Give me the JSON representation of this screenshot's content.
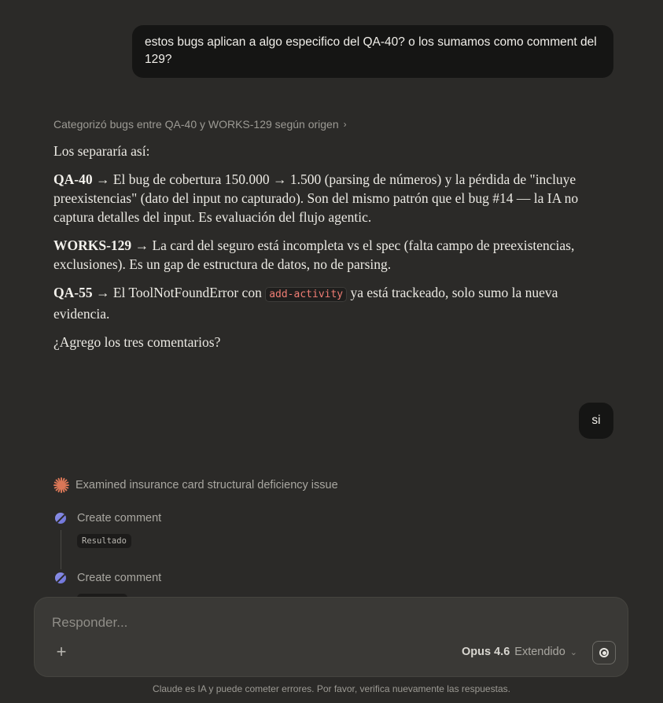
{
  "messages": {
    "user_1": "estos bugs aplican a algo especifico del QA-40? o los sumamos como comment del 129?",
    "user_2": "si"
  },
  "assistant": {
    "thinking_summary": "Categorizó bugs entre QA-40 y WORKS-129 según origen",
    "intro": "Los separaría así:",
    "items": [
      {
        "key": "QA-40",
        "arrow": "→",
        "text": "El bug de cobertura 150.000 → 1.500 (parsing de números) y la pérdida de \"incluye preexistencias\" (dato del input no capturado). Son del mismo patrón que el bug #14 — la IA no captura detalles del input. Es evaluación del flujo agentic."
      },
      {
        "key": "WORKS-129",
        "arrow": "→",
        "text": "La card del seguro está incompleta vs el spec (falta campo de preexistencias, exclusiones). Es un gap de estructura de datos, no de parsing."
      },
      {
        "key": "QA-55",
        "arrow": "→",
        "text_before": "El ToolNotFoundError con",
        "code": "add-activity",
        "text_after": "ya está trackeado, solo sumo la nueva evidencia."
      }
    ],
    "question": "¿Agrego los tres comentarios?"
  },
  "activity": {
    "header": "Examined insurance card structural deficiency issue",
    "header_icon": "sparkle-icon",
    "tools": [
      {
        "label": "Create comment",
        "result": "Resultado",
        "icon": "tool-dot-icon"
      },
      {
        "label": "Create comment",
        "icon": "tool-dot-icon"
      }
    ]
  },
  "composer": {
    "placeholder": "Responder...",
    "model_name": "Opus 4.6",
    "model_mode": "Extendido",
    "plus_icon": "plus-icon",
    "voice_icon": "voice-mode-icon"
  },
  "footer": {
    "disclaimer": "Claude es IA y puede cometer errores. Por favor, verifica nuevamente las respuestas."
  },
  "colors": {
    "background": "#2b2a28",
    "user_bubble": "#151514",
    "composer": "#3a3936",
    "code_text": "#ef7d74",
    "sparkle": "#d97757",
    "tool_dot": "#7b7fe0"
  }
}
